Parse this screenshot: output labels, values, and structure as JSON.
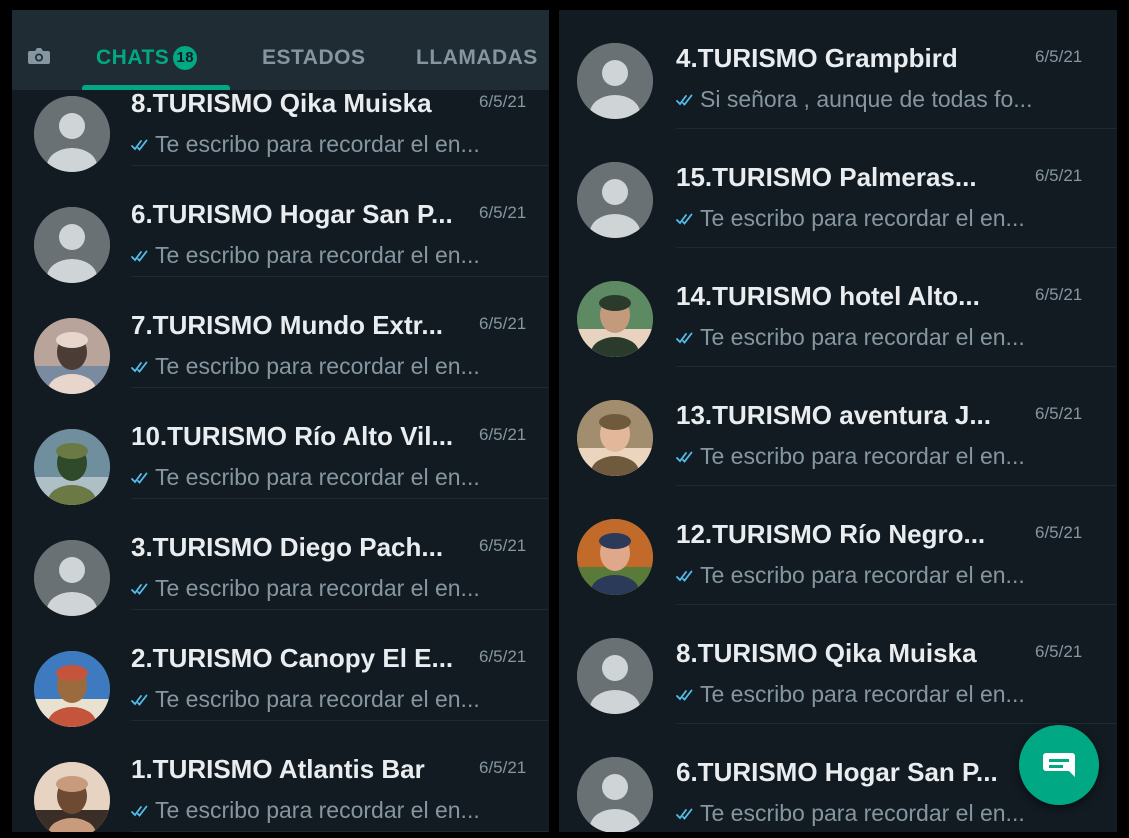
{
  "tabs": {
    "chats_label": "CHATS",
    "chats_badge": "18",
    "estados_label": "ESTADOS",
    "llamadas_label": "LLAMADAS"
  },
  "left_chats": [
    {
      "title": "8.TURISMO Qika Muiska",
      "date": "6/5/21",
      "message": "Te escribo para recordar el en...",
      "avatar": "default"
    },
    {
      "title": "6.TURISMO Hogar San P...",
      "date": "6/5/21",
      "message": "Te escribo para recordar el en...",
      "avatar": "default"
    },
    {
      "title": "7.TURISMO Mundo Extr...",
      "date": "6/5/21",
      "message": "Te escribo para recordar el en...",
      "avatar": "photo-couple"
    },
    {
      "title": "10.TURISMO Río Alto Vil...",
      "date": "6/5/21",
      "message": "Te escribo para recordar el en...",
      "avatar": "photo-landscape"
    },
    {
      "title": "3.TURISMO Diego Pach...",
      "date": "6/5/21",
      "message": "Te escribo para recordar el en...",
      "avatar": "default"
    },
    {
      "title": "2.TURISMO Canopy El E...",
      "date": "6/5/21",
      "message": "Te escribo para recordar el en...",
      "avatar": "photo-group"
    },
    {
      "title": "1.TURISMO Atlantis Bar",
      "date": "6/5/21",
      "message": "Te escribo para recordar el en...",
      "avatar": "photo-man"
    }
  ],
  "right_chats": [
    {
      "title": "4.TURISMO Grampbird",
      "date": "6/5/21",
      "message": "Si señora , aunque de todas fo...",
      "avatar": "default"
    },
    {
      "title": "15.TURISMO Palmeras...",
      "date": "6/5/21",
      "message": "Te escribo para recordar el en...",
      "avatar": "default"
    },
    {
      "title": "14.TURISMO hotel Alto...",
      "date": "6/5/21",
      "message": "Te escribo para recordar el en...",
      "avatar": "photo-man-green"
    },
    {
      "title": "13.TURISMO aventura J...",
      "date": "6/5/21",
      "message": "Te escribo para recordar el en...",
      "avatar": "photo-woman"
    },
    {
      "title": "12.TURISMO Río Negro...",
      "date": "6/5/21",
      "message": "Te escribo para recordar el en...",
      "avatar": "photo-man-orange"
    },
    {
      "title": "8.TURISMO Qika Muiska",
      "date": "6/5/21",
      "message": "Te escribo para recordar el en...",
      "avatar": "default"
    },
    {
      "title": "6.TURISMO Hogar San P...",
      "date": "",
      "message": "Te escribo para recordar el en...",
      "avatar": "default"
    }
  ],
  "icons": {
    "camera": "camera-icon",
    "read_receipt": "double-check-icon",
    "new_chat": "new-chat-icon"
  },
  "colors": {
    "background": "#121b22",
    "accent": "#00a884",
    "tick": "#53bdeb",
    "title": "#e9edef",
    "secondary": "#8696a0"
  }
}
